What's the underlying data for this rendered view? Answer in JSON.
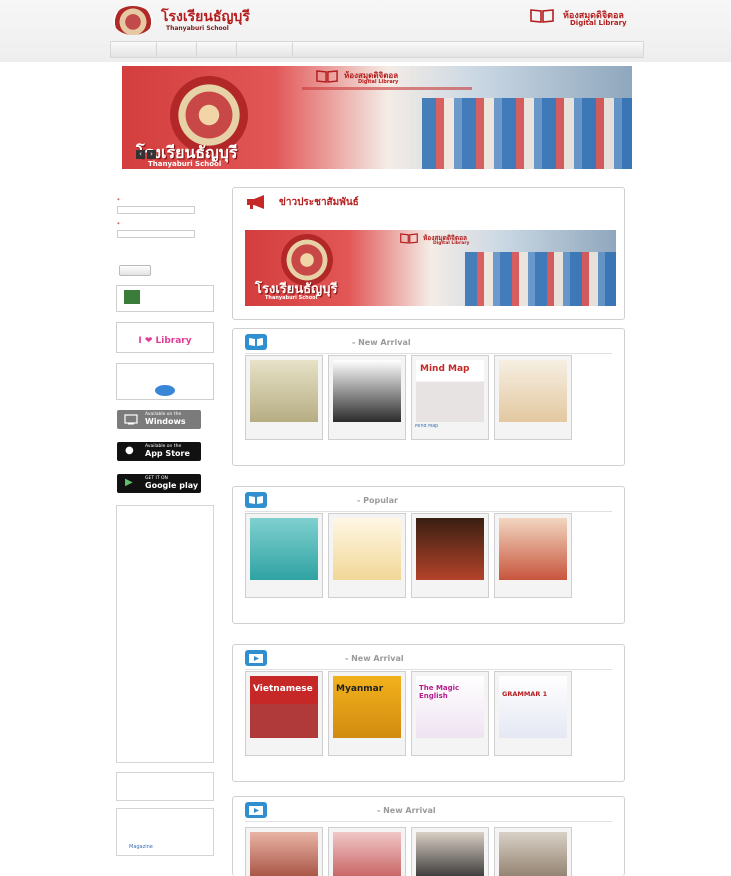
{
  "header": {
    "school_name_th": "โรงเรียนธัญบุรี",
    "school_name_en": "Thanyaburi School",
    "library_th": "ห้องสมุดดิจิตอล",
    "library_en": "Digital Library"
  },
  "nav": {
    "items": [
      "",
      "",
      "",
      ""
    ]
  },
  "banner": {
    "library_th": "ห้องสมุดดิจิตอล",
    "library_en": "Digital Library",
    "school_th": "โรงเรียนธัญบุรี",
    "school_en": "Thanyaburi School",
    "prev": "‹",
    "next": "›"
  },
  "login": {
    "title": "",
    "username_label": "",
    "password_label": "",
    "required_mark": "*",
    "forgot": "",
    "submit": ""
  },
  "side_banners": {
    "manual_line1": "",
    "manual_line2": "",
    "ebook_title": "",
    "ebook_brand": "I ❤ Library",
    "download_line1": "",
    "download_line2": "",
    "windows_small": "Available on the",
    "windows_big": "Windows",
    "appstore_small": "Available on the",
    "appstore_big": "App Store",
    "googleplay_small": "GET IT ON",
    "googleplay_big": "Google play"
  },
  "categories": {
    "title": "",
    "items": [
      "",
      "",
      "",
      "",
      "",
      "",
      "",
      "",
      "",
      "",
      "",
      "",
      "",
      "",
      "",
      "",
      "",
      "",
      "",
      "",
      "",
      "",
      "",
      "",
      "",
      "",
      "",
      "",
      "",
      "",
      "",
      "",
      "",
      "",
      "",
      ""
    ]
  },
  "video_categories": {
    "title": "",
    "items": [
      ""
    ]
  },
  "youtube_categories": {
    "title": "",
    "items": [
      "",
      "",
      "",
      "Magazine"
    ]
  },
  "news": {
    "title": "ข่าวประชาสัมพันธ์",
    "link": "",
    "more": ""
  },
  "new_books": {
    "title": "",
    "subtitle": "New Arrival",
    "more": "",
    "cards": [
      {
        "title": "",
        "category": ""
      },
      {
        "title": "",
        "category": ""
      },
      {
        "title": "Mind Map",
        "category": ""
      },
      {
        "title": "",
        "category": ""
      }
    ]
  },
  "popular_books": {
    "title": "",
    "subtitle": "Popular",
    "more": "",
    "cards": [
      {
        "title": "",
        "category": ""
      },
      {
        "title": "",
        "category": ""
      },
      {
        "title": "",
        "category": ""
      },
      {
        "title": "",
        "category": ""
      }
    ]
  },
  "new_videos": {
    "title": "",
    "subtitle": "New Arrival",
    "more": "",
    "cards": [
      {
        "title": "",
        "category": "",
        "thumb": "Vietnamese"
      },
      {
        "title": "",
        "category": "",
        "thumb": "Myanmar"
      },
      {
        "title": "",
        "category": "",
        "thumb": "The Magic English"
      },
      {
        "title": "",
        "category": "",
        "thumb": "GRAMMAR 1"
      }
    ]
  },
  "new_youtube": {
    "title": "",
    "subtitle": "New Arrival"
  }
}
